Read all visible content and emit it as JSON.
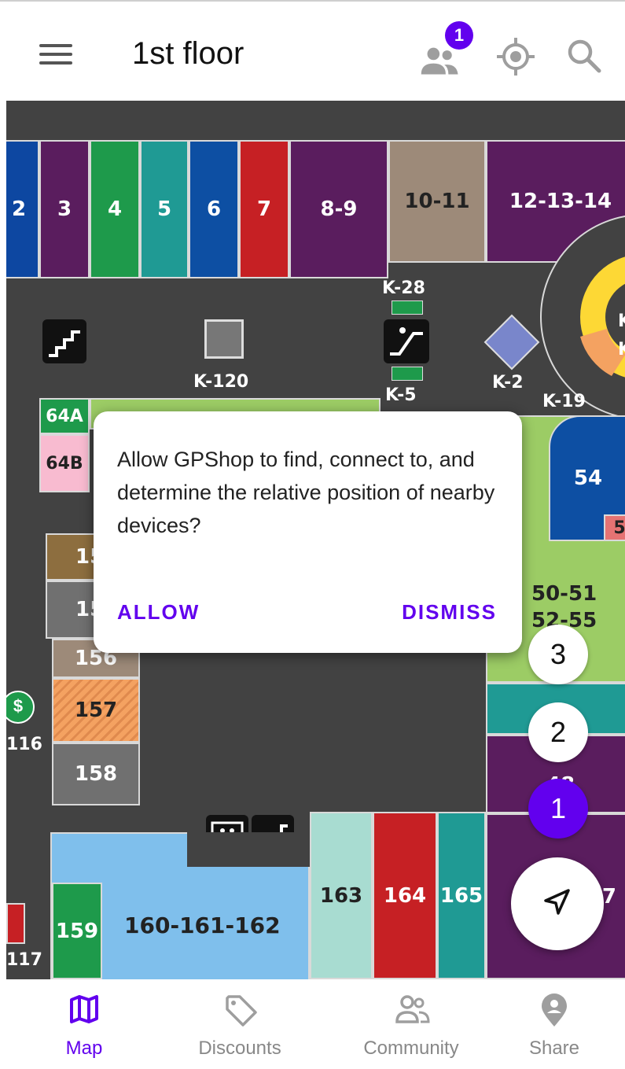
{
  "header": {
    "title": "1st floor",
    "notification_count": "1",
    "icons": [
      "menu-icon",
      "community-icon",
      "locate-icon",
      "search-icon"
    ]
  },
  "map": {
    "shops_top": [
      "2",
      "3",
      "4",
      "5",
      "6",
      "7",
      "8-9",
      "10-11",
      "12-13-14"
    ],
    "kiosks": [
      "K-28",
      "K-120",
      "K-5",
      "K-2",
      "K-19",
      "K",
      "K"
    ],
    "shops_left": [
      "64A",
      "64B",
      "15",
      "15",
      "156",
      "157",
      "158",
      "116",
      "117"
    ],
    "shops_right": [
      "54",
      "5",
      "50-51",
      "52-55",
      "48",
      "7"
    ],
    "shops_bottom": [
      "159",
      "160-161-162",
      "163",
      "164",
      "165"
    ],
    "colors": {
      "background": "#424242",
      "accent": "#6200ee"
    }
  },
  "dialog": {
    "message": "Allow GPShop to find, connect to, and determine the relative position of nearby devices?",
    "allow_label": "ALLOW",
    "dismiss_label": "DISMISS"
  },
  "floor_selector": {
    "levels": [
      "3",
      "2",
      "1"
    ],
    "active": "1"
  },
  "bottom_nav": {
    "items": [
      {
        "label": "Map",
        "icon": "map-icon",
        "active": true
      },
      {
        "label": "Discounts",
        "icon": "tag-icon",
        "active": false
      },
      {
        "label": "Community",
        "icon": "community-icon",
        "active": false
      },
      {
        "label": "Share",
        "icon": "share-location-icon",
        "active": false
      }
    ]
  }
}
